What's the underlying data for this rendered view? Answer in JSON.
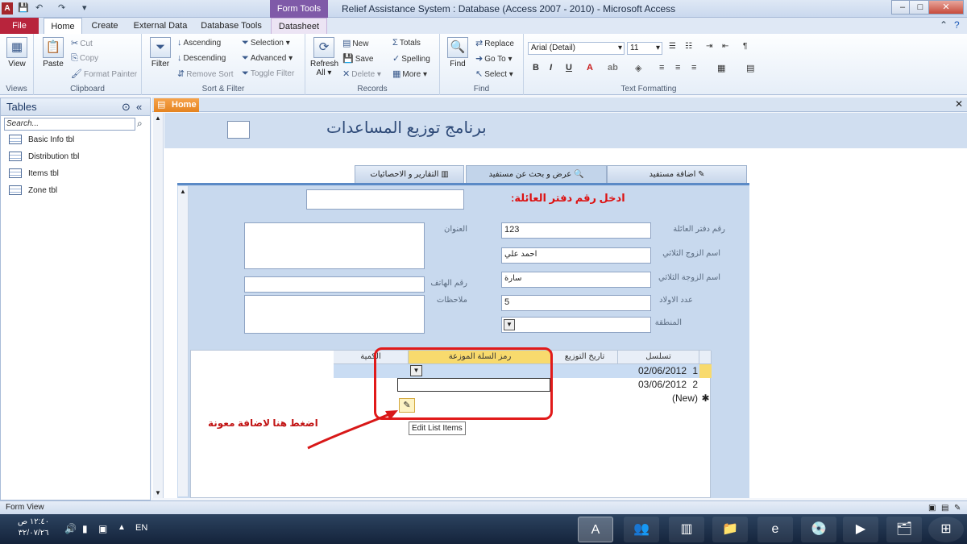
{
  "window": {
    "app_icon": "A",
    "title": "Relief Assistance System : Database (Access 2007 - 2010)  -  Microsoft Access",
    "context_tab": "Form Tools",
    "controls": [
      "–",
      "□",
      "✕"
    ]
  },
  "ribbon_tabs": [
    "File",
    "Home",
    "Create",
    "External Data",
    "Database Tools",
    "Datasheet"
  ],
  "ribbon": {
    "views": {
      "label": "Views",
      "view": "View"
    },
    "clipboard": {
      "label": "Clipboard",
      "paste": "Paste",
      "cut": "Cut",
      "copy": "Copy",
      "format_painter": "Format Painter"
    },
    "sort_filter": {
      "label": "Sort & Filter",
      "filter": "Filter",
      "ascending": "Ascending",
      "descending": "Descending",
      "remove_sort": "Remove Sort",
      "selection": "Selection ▾",
      "advanced": "Advanced ▾",
      "toggle_filter": "Toggle Filter"
    },
    "records": {
      "label": "Records",
      "refresh": "Refresh All ▾",
      "new": "New",
      "save": "Save",
      "delete": "Delete ▾",
      "totals": "Totals",
      "spelling": "Spelling",
      "more": "More ▾"
    },
    "find": {
      "label": "Find",
      "find": "Find",
      "replace": "Replace",
      "goto": "Go To ▾",
      "select": "Select ▾"
    },
    "text_formatting": {
      "label": "Text Formatting",
      "font": "Arial (Detail)",
      "size": "11"
    }
  },
  "nav": {
    "title": "Tables",
    "search_placeholder": "Search...",
    "items": [
      "Basic Info tbl",
      "Distribution tbl",
      "Items tbl",
      "Zone tbl"
    ]
  },
  "doc_tab": "Home",
  "form": {
    "title": "برنامج توزيع المساعدات",
    "tabs": [
      "اضافة مستفيد",
      "عرض و بحث عن مستفيد",
      "التقارير و الاحصائيات"
    ],
    "search_label": "ادخل رقم دفتر العائلة:",
    "fields": {
      "family_book_label": "رقم دفتر العائلة",
      "family_book_value": "123",
      "husband_label": "اسم الزوج الثلاثي",
      "husband_value": "احمد علي",
      "wife_label": "اسم الزوجة الثلاثي",
      "wife_value": "سارة",
      "children_label": "عدد الاولاد",
      "children_value": "5",
      "region_label": "المنطقة",
      "address_label": "العنوان",
      "phone_label": "رقم الهاتف",
      "notes_label": "ملاحظات"
    }
  },
  "datasheet": {
    "headers": [
      "تسلسل",
      "تاريخ التوزيع",
      "رمز السلة الموزعة",
      "الكمية"
    ],
    "rows": [
      {
        "seq": "1",
        "date": "02/06/2012"
      },
      {
        "seq": "2",
        "date": "03/06/2012"
      }
    ],
    "new_row": "(New)"
  },
  "tooltip": "Edit List Items",
  "annotation": "اضغط هنا لاضافة معونة",
  "status": "Form View",
  "taskbar": {
    "time": "١٢:٤٠ ص",
    "date": "٣٢/٠٧/٢٦",
    "lang": "EN"
  }
}
